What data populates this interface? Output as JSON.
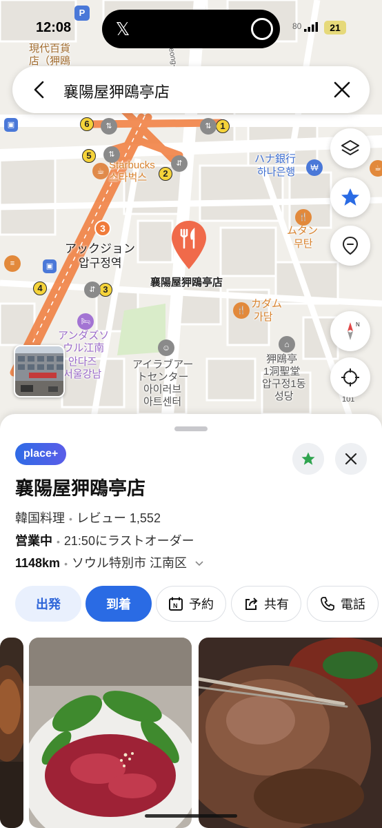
{
  "status": {
    "time": "12:08",
    "signal_text": "80",
    "battery": "21"
  },
  "search": {
    "query": "襄陽屋狎鴎亭店"
  },
  "map": {
    "labels": {
      "dept_store": "現代百貨\n店（狎鴎",
      "starbucks_en": "Starbucks",
      "starbucks_ko": "스타벅스",
      "hana_ja": "ハナ銀行",
      "hana_ko": "하나은행",
      "station_ja": "アックジョン",
      "station_ko": "압구정역",
      "pin_name": "襄陽屋狎鴎亭店",
      "mutan_ja": "ムタン",
      "mutan_ko": "무탄",
      "kadamu_ja": "カダム",
      "kadamu_ko": "가담",
      "andaz_ja": "アンダズソ\nウル江南",
      "andaz_ko": "안다즈\n서울강남",
      "arario_ja": "アイラブアー\nトセンター",
      "arario_ko": "아이러브\n아트센터",
      "church_ja": "狎鴎亭\n1洞聖堂",
      "church_ko": "압구정1동\n성당",
      "street": "Apgujeong-ro",
      "building_no": "101"
    },
    "exits": [
      "6",
      "1",
      "5",
      "2",
      "3",
      "4",
      "3"
    ],
    "line_marker": "3"
  },
  "place": {
    "badge": "place+",
    "name": "襄陽屋狎鴎亭店",
    "category": "韓国料理",
    "reviews": "レビュー 1,552",
    "open_status": "営業中",
    "last_order": "21:50にラストオーダー",
    "distance": "1148km",
    "address": "ソウル特別市 江南区"
  },
  "actions": {
    "depart": "出発",
    "arrive": "到着",
    "reserve": "予約",
    "share": "共有",
    "call": "電話"
  },
  "colors": {
    "primary": "#2a6be4",
    "subway_orange": "#f07b3a",
    "pin_red": "#f06a4a",
    "star_green": "#2fa44f"
  }
}
